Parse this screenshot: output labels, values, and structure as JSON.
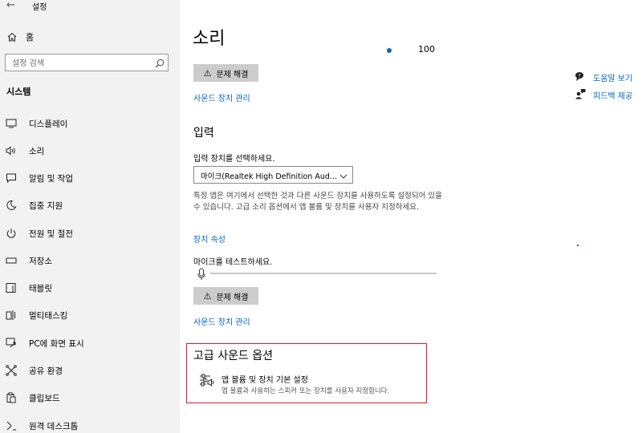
{
  "window": {
    "title": "설정"
  },
  "sidebar": {
    "home_label": "홈",
    "search_placeholder": "설정 검색",
    "section_title": "시스템",
    "items": [
      {
        "label": "디스플레이",
        "icon": "monitor-icon"
      },
      {
        "label": "소리",
        "icon": "speaker-icon"
      },
      {
        "label": "알림 및 작업",
        "icon": "notification-icon"
      },
      {
        "label": "집중 지원",
        "icon": "moon-icon"
      },
      {
        "label": "전원 및 절전",
        "icon": "power-icon"
      },
      {
        "label": "저장소",
        "icon": "storage-icon"
      },
      {
        "label": "태블릿",
        "icon": "tablet-icon"
      },
      {
        "label": "멀티태스킹",
        "icon": "multitasking-icon"
      },
      {
        "label": "PC에 화면 표시",
        "icon": "project-icon"
      },
      {
        "label": "공유 환경",
        "icon": "shared-experience-icon"
      },
      {
        "label": "클립보드",
        "icon": "clipboard-icon"
      },
      {
        "label": "원격 데스크톱",
        "icon": "remote-desktop-icon"
      }
    ]
  },
  "main": {
    "title": "소리",
    "output_volume_value": "100",
    "troubleshoot_label": "문제 해결",
    "manage_devices_link": "사운드 장치 관리",
    "input": {
      "heading": "입력",
      "select_label": "입력 장치를 선택하세요.",
      "selected_device": "마이크(Realtek High Definition Aud...",
      "description": "특정 앱은 여기에서 선택한 것과 다른 사운드 장치를 사용하도록 설정되어 있을 수 있습니다. 고급 소리 옵션에서 앱 볼륨 및 장치를 사용자 지정하세요.",
      "device_properties_link": "장치 속성",
      "mic_test_label": "마이크를 테스트하세요.",
      "troubleshoot_label": "문제 해결",
      "manage_devices_link": "사운드 장치 관리"
    },
    "advanced": {
      "heading": "고급 사운드 옵션",
      "item_title": "앱 볼륨 및 장치 기본 설정",
      "item_description": "앱 볼륨과 사용하는 스피커 또는 장치를 사용자 지정합니다."
    }
  },
  "related": {
    "help_label": "도움말 보기",
    "feedback_label": "피드백 제공"
  },
  "colors": {
    "accent": "#0067c0",
    "sidebar_bg": "#f2f2f2",
    "button_bg": "#cccccc",
    "highlight_border": "#e8132b"
  }
}
